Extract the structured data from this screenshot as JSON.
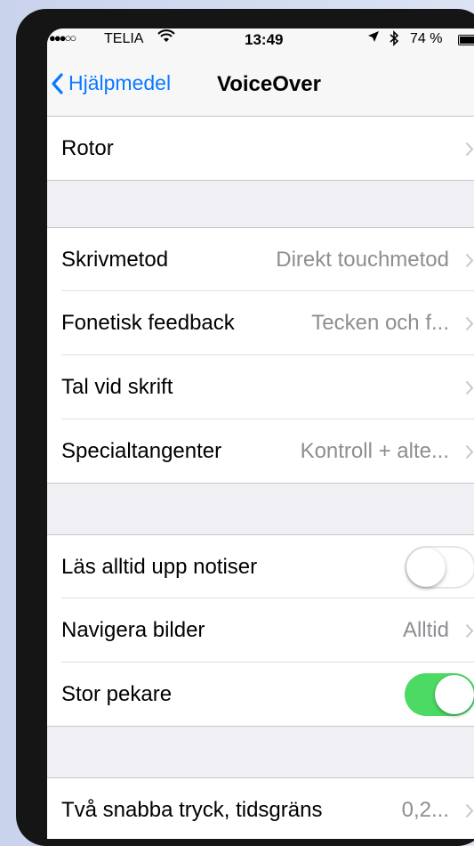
{
  "status_bar": {
    "signal": "●●●○○",
    "carrier": "TELIA",
    "time": "13:49",
    "battery_percent": "74 %",
    "battery_level": 0.74,
    "icons": [
      "wifi-icon",
      "location-icon",
      "bluetooth-icon",
      "battery-icon"
    ]
  },
  "nav": {
    "back_label": "Hjälpmedel",
    "title": "VoiceOver",
    "accent_color": "#0a7aff"
  },
  "rows": {
    "rotor": {
      "label": "Rotor",
      "value": ""
    },
    "skrivmetod": {
      "label": "Skrivmetod",
      "value": "Direkt touchmetod"
    },
    "fonetisk": {
      "label": "Fonetisk feedback",
      "value": "Tecken och f..."
    },
    "tal": {
      "label": "Tal vid skrift",
      "value": ""
    },
    "special": {
      "label": "Specialtangenter",
      "value": "Kontroll + alte..."
    },
    "notiser": {
      "label": "Läs alltid upp notiser",
      "toggle": false
    },
    "bilder": {
      "label": "Navigera bilder",
      "value": "Alltid"
    },
    "pekare": {
      "label": "Stor pekare",
      "toggle": true
    },
    "tryck": {
      "label": "Två snabba tryck, tidsgräns",
      "value": "0,2..."
    }
  },
  "colors": {
    "toggle_on": "#4cd964",
    "background": "#efeff4"
  }
}
